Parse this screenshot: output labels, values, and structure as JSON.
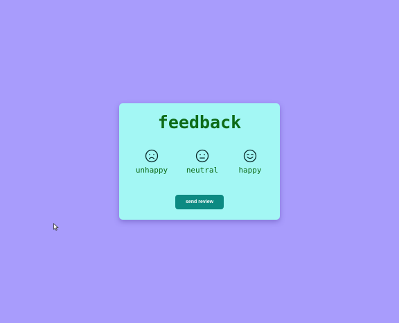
{
  "page": {
    "background_color": "#a89cfc"
  },
  "card": {
    "title": "feedback",
    "background_color": "#a3f7f4",
    "text_color": "#0d6b17",
    "options": [
      {
        "label": "unhappy",
        "icon": "sad-face-icon"
      },
      {
        "label": "neutral",
        "icon": "neutral-face-icon"
      },
      {
        "label": "happy",
        "icon": "happy-face-icon"
      }
    ],
    "send_button": {
      "label": "send review",
      "background_color": "#0c8a82",
      "text_color": "#ffffff"
    }
  },
  "cursor": {
    "icon": "mouse-pointer-icon"
  }
}
